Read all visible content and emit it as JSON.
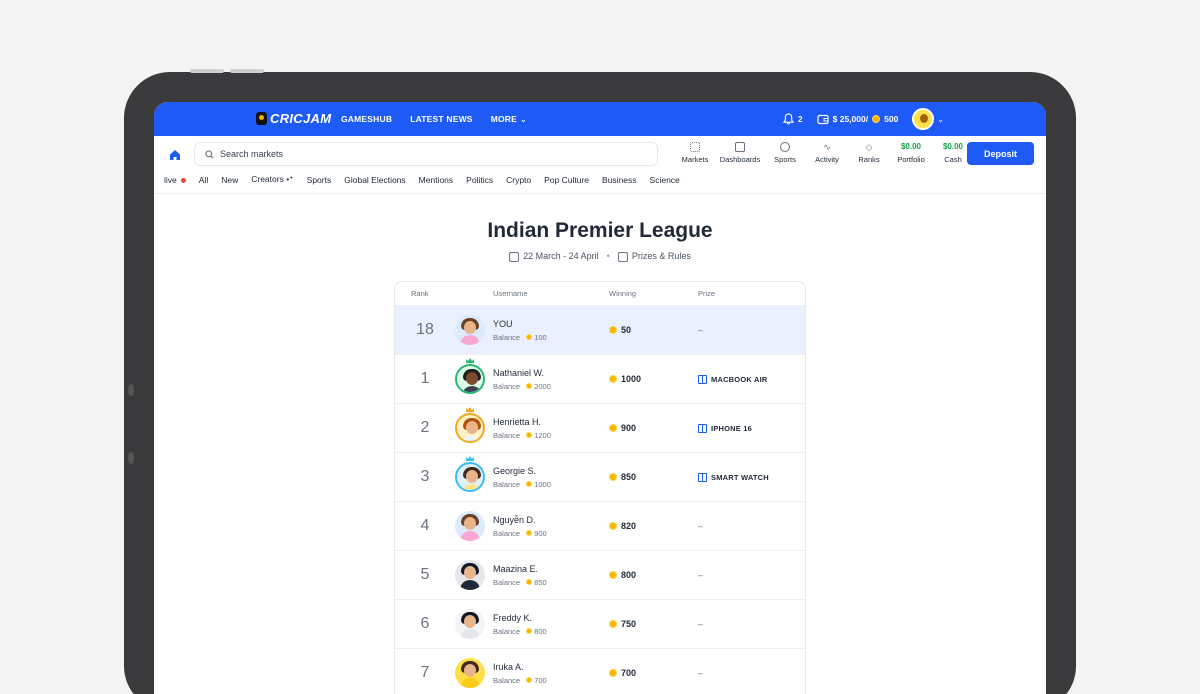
{
  "brand": "CRICJAM",
  "nav": {
    "gameshub": "GAMESHUB",
    "latest_news": "LATEST NEWS",
    "more": "MORE"
  },
  "top": {
    "notifications": "2",
    "cash": "$ 25,000/",
    "coins": "500"
  },
  "search": {
    "placeholder": "Search markets"
  },
  "quick_links": [
    {
      "label": "Markets",
      "icon": "grid-icon"
    },
    {
      "label": "Dashboards",
      "icon": "dashboard-icon"
    },
    {
      "label": "Sports",
      "icon": "ball-icon"
    },
    {
      "label": "Activity",
      "icon": "activity-icon"
    },
    {
      "label": "Ranks",
      "icon": "diamond-icon"
    },
    {
      "label": "Portfolio",
      "value": "$0.00"
    },
    {
      "label": "Cash",
      "value": "$0.00"
    }
  ],
  "deposit": "Deposit",
  "categories": [
    "live",
    "All",
    "New",
    "Creators •⁺",
    "Sports",
    "Global Elections",
    "Mentions",
    "Politics",
    "Crypto",
    "Pop Culture",
    "Business",
    "Science"
  ],
  "page": {
    "title": "Indian Premier League",
    "dates": "22 March - 24 April",
    "prizes_link": "Prizes & Rules"
  },
  "columns": {
    "rank": "Rank",
    "username": "Username",
    "winning": "Winning",
    "prize": "Prize"
  },
  "balance_label": "Balance",
  "rows": [
    {
      "rank": "18",
      "name": "YOU",
      "balance": "100",
      "winning": "50",
      "prize": "–"
    },
    {
      "rank": "1",
      "name": "Nathaniel W.",
      "balance": "2000",
      "winning": "1000",
      "prize": "MACBOOK AIR"
    },
    {
      "rank": "2",
      "name": "Henrietta H.",
      "balance": "1200",
      "winning": "900",
      "prize": "IPHONE 16"
    },
    {
      "rank": "3",
      "name": "Georgie S.",
      "balance": "1000",
      "winning": "850",
      "prize": "SMART WATCH"
    },
    {
      "rank": "4",
      "name": "Nguyễn D.",
      "balance": "900",
      "winning": "820",
      "prize": "–"
    },
    {
      "rank": "5",
      "name": "Maazina E.",
      "balance": "850",
      "winning": "800",
      "prize": "–"
    },
    {
      "rank": "6",
      "name": "Freddy K.",
      "balance": "800",
      "winning": "750",
      "prize": "–"
    },
    {
      "rank": "7",
      "name": "Iruka A.",
      "balance": "700",
      "winning": "700",
      "prize": "–"
    }
  ],
  "colors": {
    "brand_blue": "#1e5af5",
    "gold": "#f7b500",
    "ring_1": "#2bb673",
    "ring_2": "#f5a623",
    "ring_3": "#38bdf8"
  }
}
